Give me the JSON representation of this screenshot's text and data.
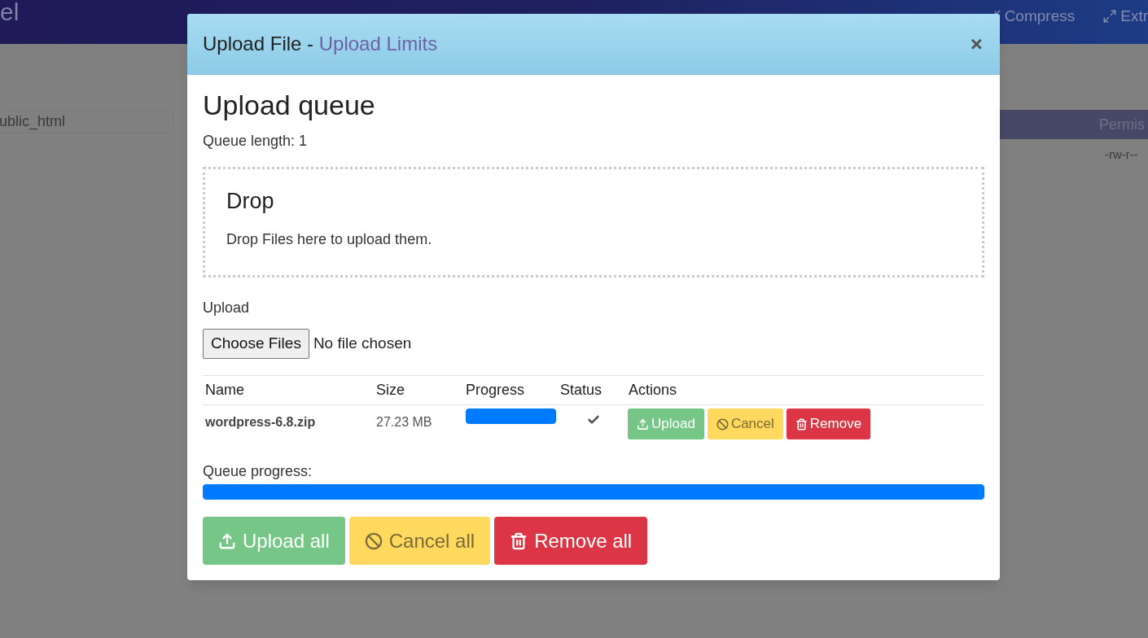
{
  "page": {
    "logo": "el",
    "toolbar": [
      {
        "kind": "compress",
        "label": "Compress"
      },
      {
        "kind": "extract",
        "label": "Extr"
      }
    ],
    "path_field": {
      "value": "ublic_html"
    },
    "file_table": {
      "columns": [
        "Permis"
      ],
      "rows": [
        [
          "-rw-r--"
        ]
      ]
    }
  },
  "modal": {
    "title": "Upload File - ",
    "title_link": "Upload Limits",
    "close": "×",
    "heading": "Upload queue",
    "queue_length": "Queue length: 1",
    "drop_zone": {
      "title": "Drop",
      "text": "Drop Files here to upload them."
    },
    "upload_label": "Upload",
    "file_input": {
      "button": "Choose Files",
      "status": "No file chosen"
    },
    "queue_table": {
      "columns": [
        "Name",
        "Size",
        "Progress",
        "Status",
        "Actions"
      ],
      "rows": [
        {
          "name": "wordpress-6.8.zip",
          "size": "27.23 MB",
          "level": 1,
          "uploaded": true,
          "actions": [
            {
              "kind": "upload",
              "label": "Upload"
            },
            {
              "kind": "cancel",
              "label": "Cancel"
            },
            {
              "kind": "remove",
              "label": "Remove"
            }
          ]
        }
      ]
    },
    "queue_progress": {
      "label": "Queue progress:",
      "level": 1
    },
    "buttons": [
      {
        "kind": "upload",
        "label": "Upload all"
      },
      {
        "kind": "cancel",
        "label": "Cancel all"
      },
      {
        "kind": "remove",
        "label": "Remove all"
      }
    ]
  }
}
